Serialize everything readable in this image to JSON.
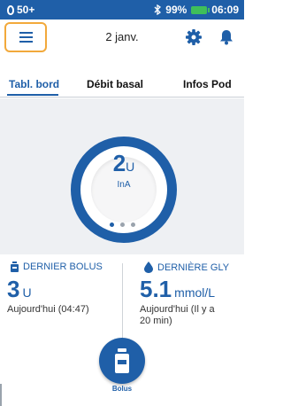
{
  "status_bar": {
    "pod_level": "50+",
    "battery_percent": "99%",
    "time": "06:09",
    "bluetooth_icon": "bluetooth-icon",
    "battery_color": "#3fbf5a"
  },
  "header": {
    "date": "2 janv.",
    "menu_icon": "hamburger-menu-icon",
    "settings_icon": "gear-icon",
    "notifications_icon": "bell-icon",
    "highlight_color": "#f2a93b"
  },
  "tabs": [
    {
      "label": "Tabl. bord",
      "active": true
    },
    {
      "label": "Débit basal",
      "active": false
    },
    {
      "label": "Infos Pod",
      "active": false
    }
  ],
  "dashboard": {
    "iob_value": "2",
    "iob_unit": "U",
    "iob_label": "InA",
    "page_count": 3,
    "active_page": 1
  },
  "last_bolus": {
    "title": "DERNIER BOLUS",
    "value": "3",
    "unit": "U",
    "when": "Aujourd'hui (04:47)"
  },
  "last_bg": {
    "title": "DERNIÈRE GLY",
    "value": "5.1",
    "unit": "mmol/L",
    "when_line1": "Aujourd'hui (Il y a",
    "when_line2": "20 min)"
  },
  "bolus_button": {
    "label": "Bolus"
  },
  "colors": {
    "primary": "#1f5fa8",
    "dashboard_bg": "#eef0f3"
  }
}
